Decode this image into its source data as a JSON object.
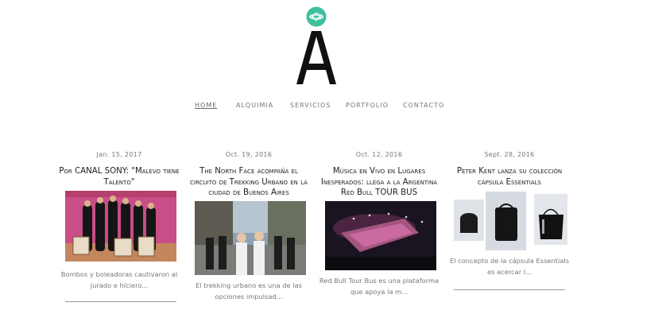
{
  "brand": {
    "logo_letter": "A",
    "accent": "#3fbf9f"
  },
  "nav": {
    "items": [
      {
        "label": "HOME"
      },
      {
        "label": "ALQUIMIA"
      },
      {
        "label": "SERVICIOS"
      },
      {
        "label": "PORTFOLIO"
      },
      {
        "label": "CONTACTO"
      }
    ]
  },
  "posts": [
    {
      "date": "Jan. 15, 2017",
      "title": "Por CANAL SONY: \"Malevo tiene Talento\"",
      "excerpt": "Bombos y boleadoras cautivaron al jurado e hiciero..."
    },
    {
      "date": "Oct. 19, 2016",
      "title": "The North Face acompaña el circuito de Trekking Urbano en la ciudad de Buenos Aires",
      "excerpt": "El trekking urbano es una de las opciones impulsad..."
    },
    {
      "date": "Oct. 12, 2016",
      "title": "Música en Vivo en Lugares Inesperados: llega a la Argentina Red Bull TOUR BUS",
      "excerpt": "Red Bull Tour Bus es una plataforma que apoya la m..."
    },
    {
      "date": "Sept. 28, 2016",
      "title": "Peter Kent lanza su colección cápsula Essentials",
      "excerpt": "El concepto de la cápsula Essentials es acercar l..."
    }
  ]
}
